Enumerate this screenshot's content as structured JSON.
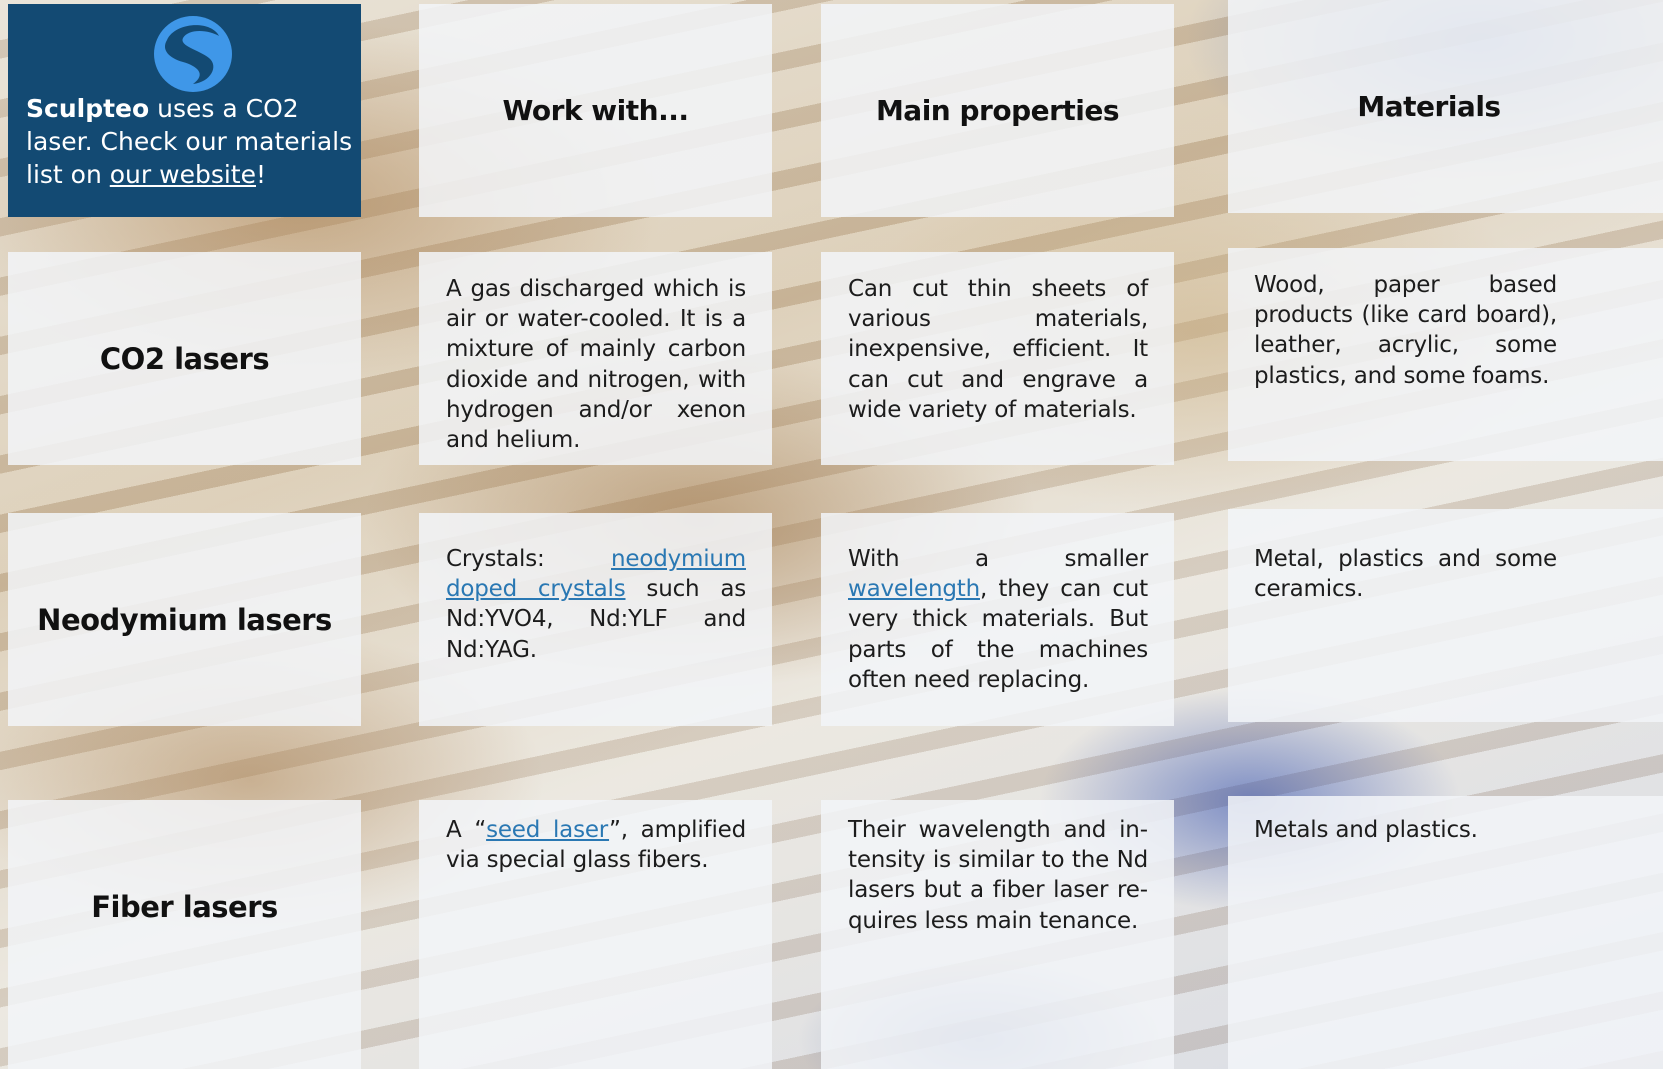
{
  "brand": {
    "name": "Sculpteo",
    "text_after_name": " uses a CO2 laser. Check our materials list on ",
    "link_text": "our website",
    "text_end": "!"
  },
  "headers": {
    "work_with": "Work with...",
    "main_properties": "Main properties",
    "materials": "Materials"
  },
  "rows": [
    {
      "title": "CO2 lasers",
      "work_with": "A gas discharged which is air or water-cooled. It is a mixture of mainly carbon dioxide and nitrogen, with hydrogen and/or xenon and helium.",
      "main_properties": "Can cut thin sheets of var­ious materials, inexpensive, efficient. It can cut and en­grave a wide variety of ma­terials.",
      "materials": "Wood, paper based products (like card board), leather, acrylic, some plastics, and some foams."
    },
    {
      "title": "Neodymium lasers",
      "work_with_prefix": "Crystals: ",
      "work_with_link": "neodymium doped crystals",
      "work_with_suffix": " such as Nd:YVO4, Nd:YLF and Nd:YAG.",
      "main_properties_prefix": "With a smaller ",
      "main_properties_link": "wavelength",
      "main_properties_suffix": ", they can cut very thick ma­terials. But parts of the ma­chines often need replacing.",
      "materials": "Metal, plastics and some ce­ramics."
    },
    {
      "title": "Fiber lasers",
      "work_with_prefix": "A “",
      "work_with_link": "seed laser",
      "work_with_suffix": "”, amplified via special glass fibers.",
      "main_properties": "Their wavelength and in­tensity is similar to the Nd lasers but a fiber laser re­quires less main tenance.",
      "materials": "Metals and plastics."
    }
  ],
  "colors": {
    "brand_bg": "#134a73",
    "logo_blue": "#3f97e8",
    "link": "#2a78b3",
    "cell_bg": "rgba(242,244,248,0.86)"
  },
  "icons": {
    "logo": "sculpteo-logo-icon"
  }
}
